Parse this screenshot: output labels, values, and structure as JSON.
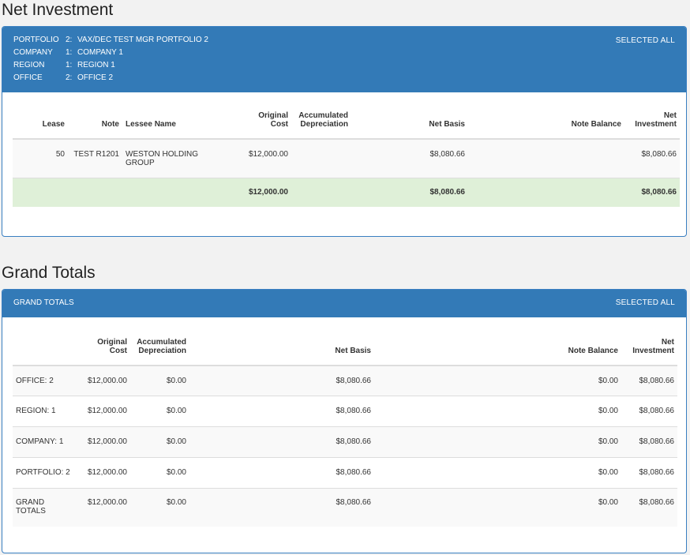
{
  "net_investment": {
    "title": "Net Investment",
    "header": {
      "rows": [
        {
          "key": "PORTFOLIO",
          "num": "2:",
          "value": "VAX/DEC TEST MGR PORTFOLIO 2"
        },
        {
          "key": "COMPANY",
          "num": "1:",
          "value": "COMPANY 1"
        },
        {
          "key": "REGION",
          "num": "1:",
          "value": "REGION 1"
        },
        {
          "key": "OFFICE",
          "num": "2:",
          "value": "OFFICE 2"
        }
      ],
      "selected": "SELECTED ALL"
    },
    "columns": {
      "lease": "Lease",
      "note": "Note",
      "lessee": "Lessee Name",
      "orig_1": "Original",
      "orig_2": "Cost",
      "accum_1": "Accumulated",
      "accum_2": "Depreciation",
      "net_basis": "Net Basis",
      "note_balance": "Note Balance",
      "net_inv_1": "Net",
      "net_inv_2": "Investment"
    },
    "rows": [
      {
        "lease": "50",
        "note": "TEST R1201",
        "lessee_1": "WESTON HOLDING",
        "lessee_2": "GROUP",
        "orig": "$12,000.00",
        "accum": "",
        "net_basis": "$8,080.66",
        "note_balance": "",
        "net_inv": "$8,080.66"
      }
    ],
    "total": {
      "orig": "$12,000.00",
      "net_basis": "$8,080.66",
      "net_inv": "$8,080.66"
    }
  },
  "grand_totals": {
    "title": "Grand Totals",
    "header_label": "GRAND TOTALS",
    "selected": "SELECTED ALL",
    "columns": {
      "orig_1": "Original",
      "orig_2": "Cost",
      "accum_1": "Accumulated",
      "accum_2": "Depreciation",
      "net_basis": "Net Basis",
      "note_balance": "Note Balance",
      "net_inv_1": "Net",
      "net_inv_2": "Investment"
    },
    "rows": [
      {
        "label_1": "OFFICE: 2",
        "label_2": "",
        "orig": "$12,000.00",
        "accum": "$0.00",
        "net_basis": "$8,080.66",
        "note_balance": "$0.00",
        "net_inv": "$8,080.66"
      },
      {
        "label_1": "REGION: 1",
        "label_2": "",
        "orig": "$12,000.00",
        "accum": "$0.00",
        "net_basis": "$8,080.66",
        "note_balance": "$0.00",
        "net_inv": "$8,080.66"
      },
      {
        "label_1": "COMPANY: 1",
        "label_2": "",
        "orig": "$12,000.00",
        "accum": "$0.00",
        "net_basis": "$8,080.66",
        "note_balance": "$0.00",
        "net_inv": "$8,080.66"
      },
      {
        "label_1": "PORTFOLIO: 2",
        "label_2": "",
        "orig": "$12,000.00",
        "accum": "$0.00",
        "net_basis": "$8,080.66",
        "note_balance": "$0.00",
        "net_inv": "$8,080.66"
      },
      {
        "label_1": "GRAND",
        "label_2": "TOTALS",
        "orig": "$12,000.00",
        "accum": "$0.00",
        "net_basis": "$8,080.66",
        "note_balance": "$0.00",
        "net_inv": "$8,080.66"
      }
    ]
  }
}
